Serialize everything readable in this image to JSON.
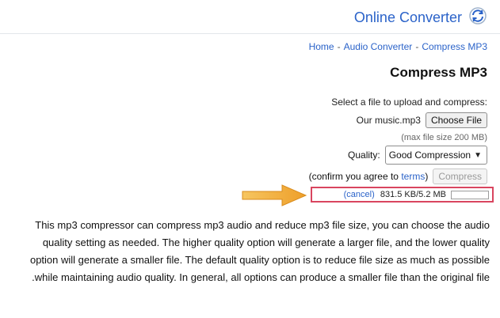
{
  "header": {
    "brand": "Online Converter",
    "logo_icon": "refresh-cycle-icon"
  },
  "breadcrumb": {
    "items": [
      "Home",
      "Audio Converter",
      "Compress MP3"
    ],
    "separator": "-"
  },
  "page": {
    "title": "Compress MP3"
  },
  "upload": {
    "label": "Select a file to upload and compress:",
    "choose_button": "Choose File",
    "filename": "Our music.mp3",
    "max_size": "(max file size 200 MB)"
  },
  "quality": {
    "label": "Quality:",
    "selected": "Good Compression"
  },
  "compress": {
    "button": "Compress",
    "confirm_text": "(confirm you agree to",
    "terms_link": "terms",
    "confirm_close": ")"
  },
  "progress": {
    "fraction": 0.0,
    "text": "831.5 KB/5.2 MB",
    "cancel": "(cancel)"
  },
  "description": {
    "text": "This mp3 compressor can compress mp3 audio and reduce mp3 file size, you can choose the audio quality setting as needed. The higher quality option will generate a larger file, and the lower quality option will generate a smaller file. The default quality option is to reduce file size as much as possible while maintaining audio quality. In general, all options can produce a smaller file than the original file."
  },
  "colors": {
    "accent": "#2b63c9",
    "highlight_border": "#d9455f",
    "arrow": "#f2b036"
  }
}
